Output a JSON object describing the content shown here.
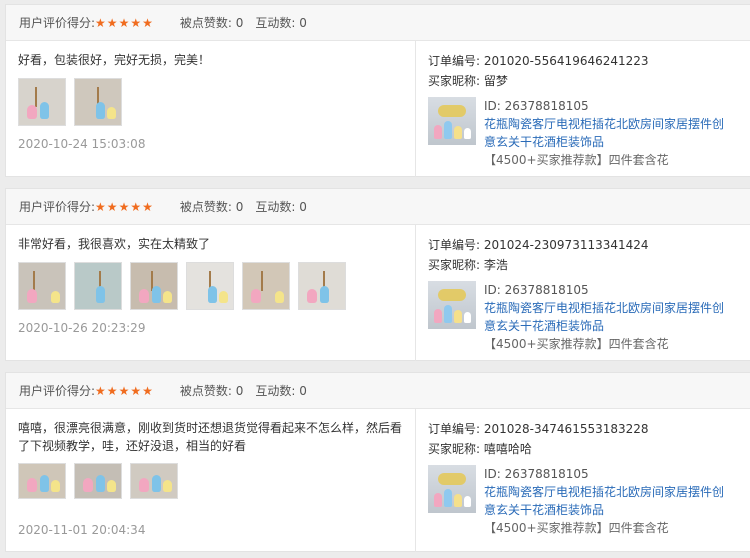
{
  "reviews": [
    {
      "rating_label": "用户评价得分:",
      "stars": "★★★★★",
      "likes": "被点赞数: 0",
      "interactions": "互动数: 0",
      "text": "好看，包装很好，完好无损，完美！",
      "image_count": 2,
      "time": "2020-10-24 15:03:08",
      "order_label": "订单编号:",
      "order_no": "201020-556419646241223",
      "buyer_label": "买家昵称:",
      "buyer": "留梦",
      "product_id": "ID: 26378818105",
      "product_title": "花瓶陶瓷客厅电视柜插花北欧房间家居摆件创意玄关干花酒柜装饰品",
      "sku": "【4500+买家推荐款】四件套含花"
    },
    {
      "rating_label": "用户评价得分:",
      "stars": "★★★★★",
      "likes": "被点赞数: 0",
      "interactions": "互动数: 0",
      "text": "非常好看，我很喜欢，实在太精致了",
      "image_count": 6,
      "time": "2020-10-26 20:23:29",
      "order_label": "订单编号:",
      "order_no": "201024-230973113341424",
      "buyer_label": "买家昵称:",
      "buyer": "李浩",
      "product_id": "ID: 26378818105",
      "product_title": "花瓶陶瓷客厅电视柜插花北欧房间家居摆件创意玄关干花酒柜装饰品",
      "sku": "【4500+买家推荐款】四件套含花"
    },
    {
      "rating_label": "用户评价得分:",
      "stars": "★★★★★",
      "likes": "被点赞数: 0",
      "interactions": "互动数: 0",
      "text": "嘻嘻，很漂亮很满意，刚收到货时还想退货觉得看起来不怎么样，然后看了下视频教学，哇，还好没退，相当的好看",
      "image_count": 3,
      "time": "2020-11-01 20:04:34",
      "order_label": "订单编号:",
      "order_no": "201028-347461553183228",
      "buyer_label": "买家昵称:",
      "buyer": "嘻嘻哈哈",
      "product_id": "ID: 26378818105",
      "product_title": "花瓶陶瓷客厅电视柜插花北欧房间家居摆件创意玄关干花酒柜装饰品",
      "sku": "【4500+买家推荐款】四件套含花"
    }
  ],
  "colors": {
    "stars": "#f06c1f",
    "link": "#2a6bb8",
    "header_bg": "#f7f7f7"
  }
}
